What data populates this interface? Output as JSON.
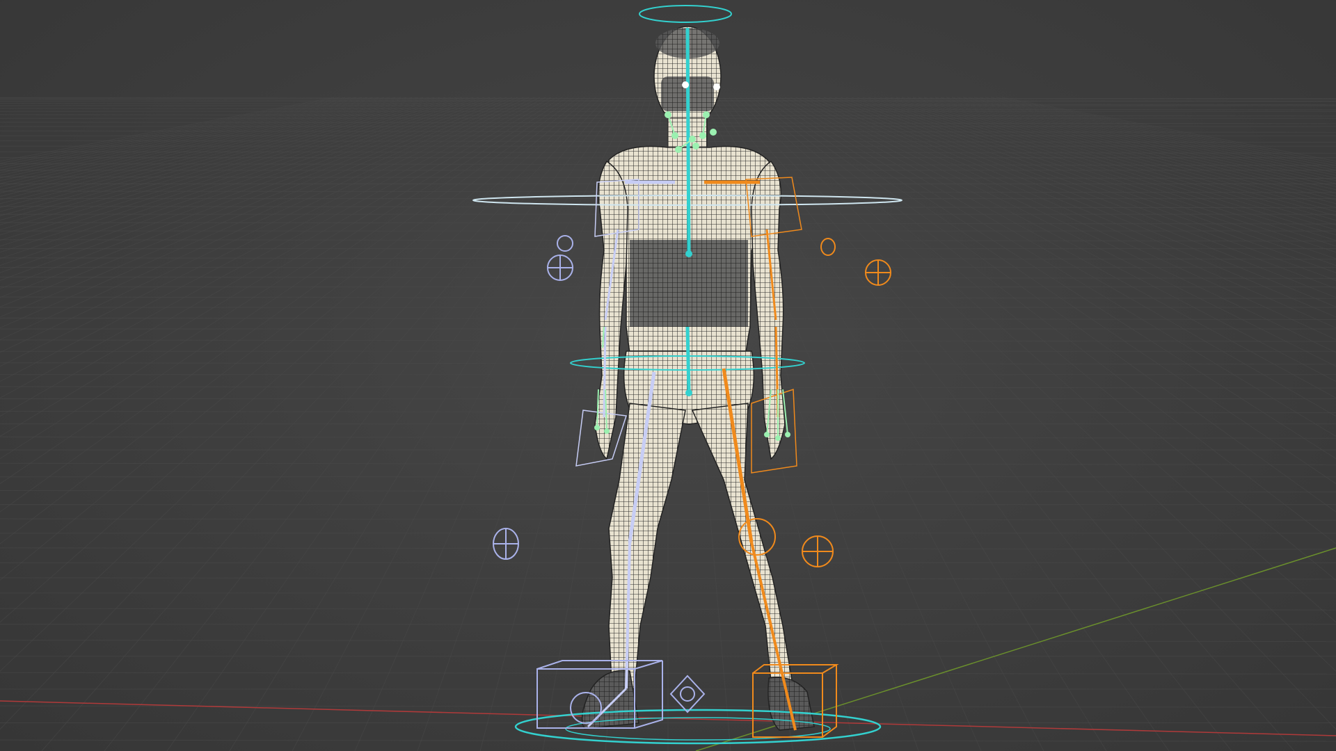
{
  "viewport": {
    "background": "#3d3d3d",
    "x_axis_color": "#b03a3a",
    "y_axis_color": "#6a8f2c"
  },
  "rig": {
    "spine_color": "#33d1cf",
    "left_side_color": "#c7cdf5",
    "right_side_color": "#f08a1c",
    "finger_color": "#9bf0b0",
    "mesh_color": "#e6e0cf",
    "icons": [
      "head-ring-icon",
      "root-ring-icon",
      "ik-target-icon",
      "pole-target-icon",
      "cube-control-icon",
      "diamond-target-icon"
    ]
  }
}
